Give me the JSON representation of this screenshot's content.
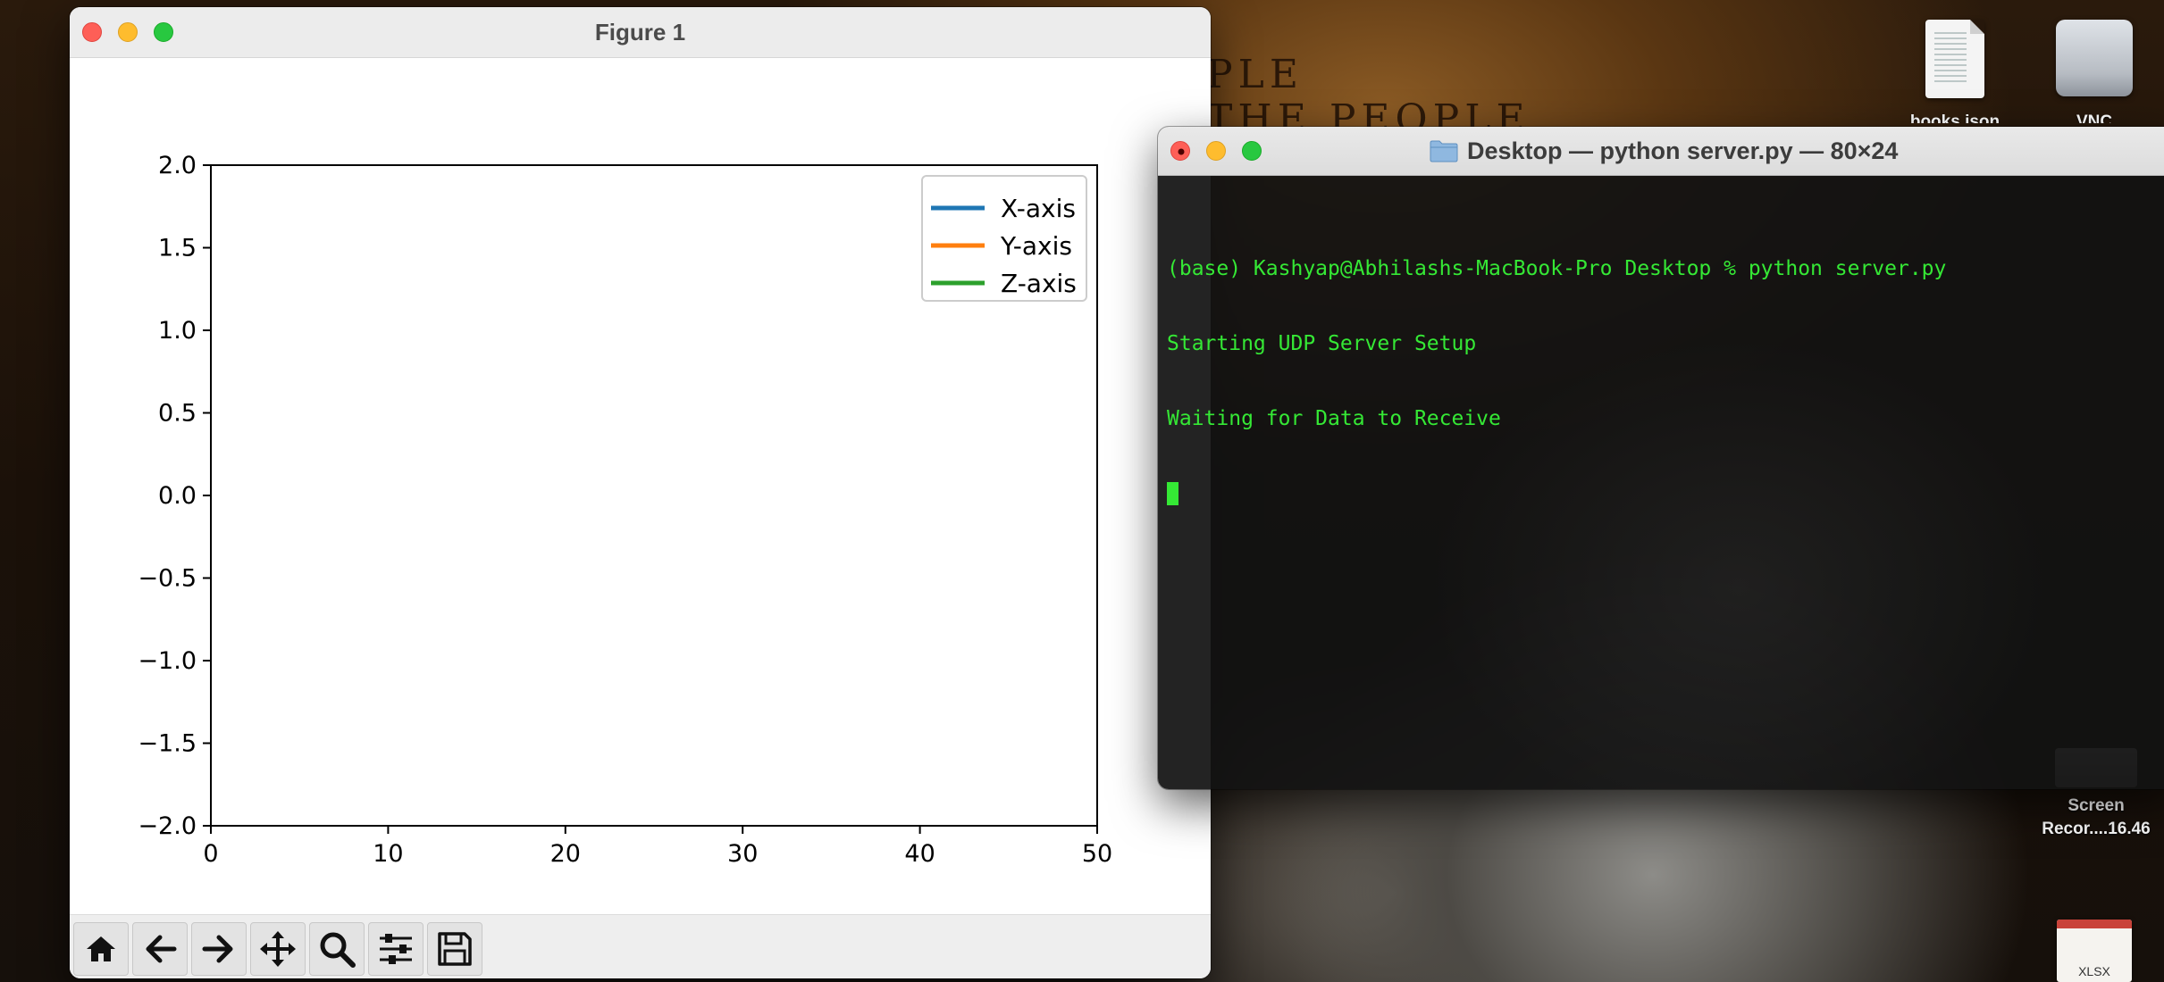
{
  "desktop": {
    "wall_text_line1": "PLE",
    "wall_text_line2": "THE PEOPLE",
    "icons": [
      {
        "label": "books.json",
        "icon": "json-file-icon"
      },
      {
        "label": "VNC",
        "icon": "drive-icon"
      },
      {
        "label_line1": "Screen",
        "label_line2": "Recor....16.46",
        "icon": "screen-recording-file-icon"
      },
      {
        "label": "XLSX",
        "icon": "xlsx-file-icon"
      }
    ]
  },
  "figure_window": {
    "title": "Figure 1",
    "toolbar": [
      {
        "name": "home-button",
        "icon": "home-icon"
      },
      {
        "name": "back-button",
        "icon": "arrow-left-icon"
      },
      {
        "name": "forward-button",
        "icon": "arrow-right-icon"
      },
      {
        "name": "pan-button",
        "icon": "move-icon"
      },
      {
        "name": "zoom-button",
        "icon": "search-icon"
      },
      {
        "name": "configure-subplots-button",
        "icon": "sliders-icon"
      },
      {
        "name": "save-button",
        "icon": "floppy-disk-icon"
      }
    ]
  },
  "chart_data": {
    "type": "line",
    "title": "",
    "xlabel": "",
    "ylabel": "",
    "xlim": [
      0,
      50
    ],
    "ylim": [
      -2.0,
      2.0
    ],
    "x_ticks": [
      "0",
      "10",
      "20",
      "30",
      "40",
      "50"
    ],
    "x_tick_values": [
      0,
      10,
      20,
      30,
      40,
      50
    ],
    "y_ticks": [
      "2.0",
      "1.5",
      "1.0",
      "0.5",
      "0.0",
      "−0.5",
      "−1.0",
      "−1.5",
      "−2.0"
    ],
    "y_tick_values": [
      2.0,
      1.5,
      1.0,
      0.5,
      0.0,
      -0.5,
      -1.0,
      -1.5,
      -2.0
    ],
    "grid": false,
    "legend_position": "top-right",
    "series": [
      {
        "name": "X-axis",
        "color": "#1f77b4",
        "x": [],
        "y": []
      },
      {
        "name": "Y-axis",
        "color": "#ff7f0e",
        "x": [],
        "y": []
      },
      {
        "name": "Z-axis",
        "color": "#2ca02c",
        "x": [],
        "y": []
      }
    ]
  },
  "terminal": {
    "title": "Desktop — python server.py — 80×24",
    "lines": [
      "(base) Kashyap@Abhilashs-MacBook-Pro Desktop % python server.py",
      "Starting UDP Server Setup",
      "Waiting for Data to Receive"
    ],
    "text_color": "#35e835"
  }
}
